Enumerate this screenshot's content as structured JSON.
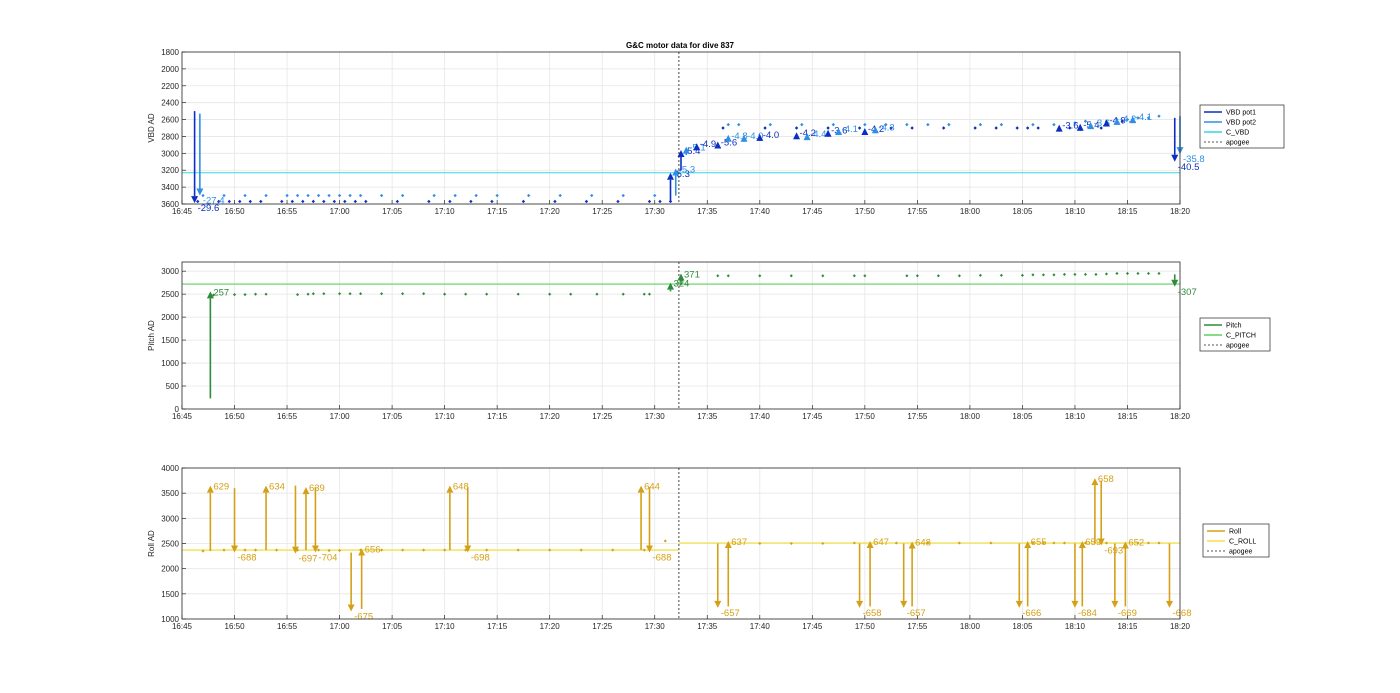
{
  "title": "G&C motor data for dive 837",
  "chart_data": [
    {
      "type": "line",
      "ylabel": "VBD AD",
      "xlabel": "",
      "ylim": [
        1800,
        3600
      ],
      "y_reversed": true,
      "yticks": [
        "1800",
        "2000",
        "2200",
        "2400",
        "2600",
        "2800",
        "3000",
        "3200",
        "3400",
        "3600"
      ],
      "xlim": [
        "16:45",
        "18:20"
      ],
      "xticks": [
        "16:45",
        "16:50",
        "16:55",
        "17:00",
        "17:05",
        "17:10",
        "17:15",
        "17:20",
        "17:25",
        "17:30",
        "17:35",
        "17:40",
        "17:45",
        "17:50",
        "17:55",
        "18:00",
        "18:05",
        "18:10",
        "18:15",
        "18:20"
      ],
      "grid": true,
      "apogee": "17:32.3",
      "legend": {
        "placement": "outside-right",
        "entries": [
          "VBD pot1",
          "VBD pot2",
          "C_VBD",
          "apogee"
        ]
      },
      "colors": {
        "VBD pot1": "#0b2fc0",
        "VBD pot2": "#2f8fe6",
        "C_VBD": "#33d6e6",
        "apogee": "#555555"
      },
      "c_vbd_level": 3230,
      "pot1_points": {
        "x": [
          "16:46.5",
          "16:48.5",
          "16:49.5",
          "16:50.5",
          "16:51.5",
          "16:52.5",
          "16:54.5",
          "16:55.5",
          "16:56.5",
          "16:57.5",
          "16:58.5",
          "16:59.5",
          "17:00.5",
          "17:01.5",
          "17:02.5",
          "17:05.5",
          "17:08.5",
          "17:10.5",
          "17:12.5",
          "17:14.5",
          "17:17.5",
          "17:20.5",
          "17:23.5",
          "17:26.5",
          "17:29.5",
          "17:30.5",
          "17:31.5",
          "17:36.5",
          "17:40.5",
          "17:43.5",
          "17:46.5",
          "17:49.5",
          "17:52.5",
          "17:54.5",
          "17:57.5",
          "18:00.5",
          "18:02.5",
          "18:04.5",
          "18:05.5",
          "18:06.5",
          "18:08.5",
          "18:09.5",
          "18:12.5",
          "18:14.5"
        ],
        "y": [
          3570,
          3570,
          3570,
          3570,
          3570,
          3570,
          3570,
          3570,
          3570,
          3570,
          3570,
          3570,
          3570,
          3570,
          3570,
          3570,
          3570,
          3570,
          3570,
          3570,
          3570,
          3570,
          3570,
          3570,
          3570,
          3570,
          3570,
          2700,
          2700,
          2700,
          2700,
          2700,
          2700,
          2700,
          2700,
          2700,
          2700,
          2700,
          2700,
          2700,
          2700,
          2700,
          2700,
          2620
        ]
      },
      "pot2_points": {
        "x": [
          "16:47",
          "16:49",
          "16:51",
          "16:53",
          "16:55",
          "16:56",
          "16:57",
          "16:58",
          "16:59",
          "17:00",
          "17:01",
          "17:02",
          "17:04",
          "17:06",
          "17:09",
          "17:11",
          "17:13",
          "17:15",
          "17:18",
          "17:21",
          "17:24",
          "17:27",
          "17:30",
          "17:37",
          "17:38",
          "17:41",
          "17:44",
          "17:47",
          "17:50",
          "17:52",
          "17:54",
          "17:56",
          "17:58",
          "18:01",
          "18:03",
          "18:06",
          "18:08",
          "18:10",
          "18:11",
          "18:13",
          "18:14",
          "18:15",
          "18:16",
          "18:17",
          "18:18"
        ],
        "y": [
          3500,
          3500,
          3500,
          3500,
          3500,
          3500,
          3500,
          3500,
          3500,
          3500,
          3500,
          3500,
          3500,
          3500,
          3500,
          3500,
          3500,
          3500,
          3500,
          3500,
          3500,
          3500,
          3500,
          2660,
          2660,
          2660,
          2660,
          2660,
          2660,
          2660,
          2660,
          2660,
          2660,
          2660,
          2660,
          2660,
          2660,
          2640,
          2620,
          2620,
          2600,
          2600,
          2580,
          2580,
          2560
        ]
      },
      "arrows": [
        {
          "series": "VBD pot1",
          "x": "16:46.2",
          "from": 2500,
          "to": 3590,
          "label": "-29.6"
        },
        {
          "series": "VBD pot2",
          "x": "16:46.7",
          "from": 2530,
          "to": 3500,
          "label": "-27.4"
        },
        {
          "series": "VBD pot1",
          "x": "17:31.5",
          "from": 3570,
          "to": 3230,
          "label": "-5.3"
        },
        {
          "series": "VBD pot2",
          "x": "17:32",
          "from": 3500,
          "to": 3180,
          "label": "-5.3"
        },
        {
          "series": "VBD pot1",
          "x": "17:32.5",
          "from": 3200,
          "to": 2960,
          "label": "-5.4"
        },
        {
          "series": "VBD pot2",
          "x": "17:33",
          "from": 3020,
          "to": 2920,
          "label": "-5.1"
        },
        {
          "series": "VBD pot1",
          "x": "17:34",
          "from": 2960,
          "to": 2880,
          "label": "-4.9"
        },
        {
          "series": "VBD pot1",
          "x": "17:36",
          "from": 2940,
          "to": 2860,
          "label": "-5.6"
        },
        {
          "series": "VBD pot2",
          "x": "17:37",
          "from": 2860,
          "to": 2780,
          "label": "-4.8"
        },
        {
          "series": "VBD pot2",
          "x": "17:38.5",
          "from": 2840,
          "to": 2780,
          "label": "-4.0"
        },
        {
          "series": "VBD pot1",
          "x": "17:40",
          "from": 2800,
          "to": 2770,
          "label": "-4.0"
        },
        {
          "series": "VBD pot1",
          "x": "17:43.5",
          "from": 2780,
          "to": 2750,
          "label": "-4.2"
        },
        {
          "series": "VBD pot2",
          "x": "17:44.5",
          "from": 2800,
          "to": 2760,
          "label": "-4.4"
        },
        {
          "series": "VBD pot1",
          "x": "17:46.5",
          "from": 2760,
          "to": 2720,
          "label": "-3.6"
        },
        {
          "series": "VBD pot2",
          "x": "17:47.5",
          "from": 2740,
          "to": 2700,
          "label": "-4.1"
        },
        {
          "series": "VBD pot1",
          "x": "17:50",
          "from": 2740,
          "to": 2700,
          "label": "-4.2"
        },
        {
          "series": "VBD pot2",
          "x": "17:51",
          "from": 2720,
          "to": 2680,
          "label": "-4.3"
        },
        {
          "series": "VBD pot1",
          "x": "18:08.5",
          "from": 2690,
          "to": 2660,
          "label": "-3.6"
        },
        {
          "series": "VBD pot1",
          "x": "18:10.5",
          "from": 2680,
          "to": 2650,
          "label": "-5.4"
        },
        {
          "series": "VBD pot2",
          "x": "18:11.5",
          "from": 2660,
          "to": 2630,
          "label": "-3.6"
        },
        {
          "series": "VBD pot1",
          "x": "18:13",
          "from": 2640,
          "to": 2600,
          "label": "-4.9"
        },
        {
          "series": "VBD pot2",
          "x": "18:14",
          "from": 2620,
          "to": 2580,
          "label": "-4.2"
        },
        {
          "series": "VBD pot2",
          "x": "18:15.5",
          "from": 2600,
          "to": 2560,
          "label": "-4.1"
        },
        {
          "series": "VBD pot1",
          "x": "18:19.5",
          "from": 2580,
          "to": 3100,
          "label": "-40.5"
        },
        {
          "series": "VBD pot2",
          "x": "18:20",
          "from": 2560,
          "to": 3010,
          "label": "-35.8"
        }
      ]
    },
    {
      "type": "line",
      "ylabel": "Pitch AD",
      "xlabel": "",
      "ylim": [
        0,
        3200
      ],
      "yticks": [
        "0",
        "500",
        "1000",
        "1500",
        "2000",
        "2500",
        "3000"
      ],
      "xlim": [
        "16:45",
        "18:20"
      ],
      "xticks": [
        "16:45",
        "16:50",
        "16:55",
        "17:00",
        "17:05",
        "17:10",
        "17:15",
        "17:20",
        "17:25",
        "17:30",
        "17:35",
        "17:40",
        "17:45",
        "17:50",
        "17:55",
        "18:00",
        "18:05",
        "18:10",
        "18:15",
        "18:20"
      ],
      "grid": true,
      "apogee": "17:32.3",
      "legend": {
        "placement": "outside-right",
        "entries": [
          "Pitch",
          "C_PITCH",
          "apogee"
        ]
      },
      "colors": {
        "Pitch": "#2e8b3a",
        "C_PITCH": "#5ed05e",
        "apogee": "#555555"
      },
      "c_pitch_level": 2720,
      "points": {
        "x": [
          "16:48",
          "16:50",
          "16:51",
          "16:52",
          "16:53",
          "16:56",
          "16:57",
          "16:57.5",
          "16:58.5",
          "17:00",
          "17:01",
          "17:02",
          "17:04",
          "17:06",
          "17:08",
          "17:10",
          "17:12",
          "17:14",
          "17:17",
          "17:20",
          "17:22",
          "17:24.5",
          "17:27",
          "17:29",
          "17:29.5",
          "17:36",
          "17:37",
          "17:40",
          "17:43",
          "17:46",
          "17:49",
          "17:50",
          "17:54",
          "17:55",
          "17:57",
          "17:59",
          "18:01",
          "18:03",
          "18:05",
          "18:06",
          "18:07",
          "18:08",
          "18:09",
          "18:10",
          "18:11",
          "18:12",
          "18:13",
          "18:14",
          "18:15",
          "18:16",
          "18:17",
          "18:18"
        ],
        "y": [
          2480,
          2490,
          2490,
          2500,
          2500,
          2490,
          2500,
          2510,
          2510,
          2510,
          2510,
          2510,
          2510,
          2510,
          2510,
          2500,
          2500,
          2500,
          2500,
          2500,
          2500,
          2500,
          2500,
          2500,
          2500,
          2900,
          2900,
          2900,
          2900,
          2900,
          2900,
          2900,
          2900,
          2900,
          2900,
          2900,
          2910,
          2910,
          2910,
          2920,
          2920,
          2920,
          2930,
          2930,
          2930,
          2930,
          2940,
          2950,
          2950,
          2950,
          2950,
          2950
        ]
      },
      "arrows": [
        {
          "x": "16:47.7",
          "from": 230,
          "to": 2560,
          "label": "257"
        },
        {
          "x": "17:31.5",
          "from": 2560,
          "to": 2750,
          "label": "324"
        },
        {
          "x": "17:32.5",
          "from": 2700,
          "to": 2950,
          "label": "371"
        },
        {
          "x": "18:19.5",
          "from": 2930,
          "to": 2660,
          "label": "-307"
        }
      ]
    },
    {
      "type": "line",
      "ylabel": "Roll AD",
      "xlabel": "",
      "ylim": [
        1000,
        4000
      ],
      "yticks": [
        "1000",
        "1500",
        "2000",
        "2500",
        "3000",
        "3500",
        "4000"
      ],
      "xlim": [
        "16:45",
        "18:20"
      ],
      "xticks": [
        "16:45",
        "16:50",
        "16:55",
        "17:00",
        "17:05",
        "17:10",
        "17:15",
        "17:20",
        "17:25",
        "17:30",
        "17:35",
        "17:40",
        "17:45",
        "17:50",
        "17:55",
        "18:00",
        "18:05",
        "18:10",
        "18:15",
        "18:20"
      ],
      "grid": true,
      "apogee": "17:32.3",
      "legend": {
        "placement": "outside-right",
        "entries": [
          "Roll",
          "C_ROLL",
          "apogee"
        ]
      },
      "colors": {
        "Roll": "#d4a017",
        "C_ROLL": "#f2e14a",
        "apogee": "#555555"
      },
      "c_roll_levels": [
        {
          "from": "16:45",
          "to": "17:32.3",
          "y": 2370
        },
        {
          "from": "17:32.3",
          "to": "18:20",
          "y": 2510
        }
      ],
      "points": {
        "x": [
          "16:47",
          "16:49",
          "16:51",
          "16:52",
          "16:54",
          "16:56",
          "16:58",
          "16:59",
          "17:00",
          "17:02",
          "17:04",
          "17:06",
          "17:08",
          "17:10",
          "17:12",
          "17:14",
          "17:17",
          "17:20",
          "17:23",
          "17:26",
          "17:29",
          "17:31",
          "17:40",
          "17:43",
          "17:46",
          "17:49",
          "17:53",
          "17:56",
          "17:59",
          "18:02",
          "18:06",
          "18:07",
          "18:08",
          "18:09",
          "18:11",
          "18:13",
          "18:16",
          "18:17",
          "18:18"
        ],
        "y": [
          2350,
          2370,
          2370,
          2370,
          2370,
          2370,
          2370,
          2360,
          2360,
          2370,
          2370,
          2370,
          2370,
          2370,
          2370,
          2370,
          2370,
          2370,
          2370,
          2370,
          2370,
          2550,
          2500,
          2500,
          2500,
          2510,
          2510,
          2510,
          2510,
          2510,
          2510,
          2510,
          2510,
          2510,
          2510,
          2510,
          2510,
          2510,
          2510
        ]
      },
      "arrows": [
        {
          "x": "16:47.7",
          "from": 2350,
          "to": 3650,
          "label": "629"
        },
        {
          "x": "16:50",
          "from": 3600,
          "to": 2320,
          "label": "-688"
        },
        {
          "x": "16:53",
          "from": 2370,
          "to": 3650,
          "label": "634"
        },
        {
          "x": "16:55.8",
          "from": 3650,
          "to": 2300,
          "label": "-697"
        },
        {
          "x": "16:56.8",
          "from": 2370,
          "to": 3620,
          "label": "639"
        },
        {
          "x": "16:57.7",
          "from": 3620,
          "to": 2320,
          "label": "-704"
        },
        {
          "x": "17:01.1",
          "from": 2320,
          "to": 1150,
          "label": "-675"
        },
        {
          "x": "17:02.1",
          "from": 1200,
          "to": 2400,
          "label": "656"
        },
        {
          "x": "17:10.5",
          "from": 2370,
          "to": 3650,
          "label": "648"
        },
        {
          "x": "17:12.2",
          "from": 3620,
          "to": 2320,
          "label": "-698"
        },
        {
          "x": "17:28.7",
          "from": 2370,
          "to": 3650,
          "label": "644"
        },
        {
          "x": "17:29.5",
          "from": 3620,
          "to": 2320,
          "label": "-688"
        },
        {
          "x": "17:36",
          "from": 2500,
          "to": 1220,
          "label": "-657"
        },
        {
          "x": "17:37",
          "from": 1250,
          "to": 2550,
          "label": "637"
        },
        {
          "x": "17:49.5",
          "from": 2500,
          "to": 1220,
          "label": "-658"
        },
        {
          "x": "17:50.5",
          "from": 1250,
          "to": 2550,
          "label": "647"
        },
        {
          "x": "17:53.7",
          "from": 2500,
          "to": 1220,
          "label": "-657"
        },
        {
          "x": "17:54.5",
          "from": 1250,
          "to": 2540,
          "label": "648"
        },
        {
          "x": "18:04.7",
          "from": 2500,
          "to": 1220,
          "label": "-666"
        },
        {
          "x": "18:05.5",
          "from": 1250,
          "to": 2550,
          "label": "655"
        },
        {
          "x": "18:10",
          "from": 2500,
          "to": 1220,
          "label": "-684"
        },
        {
          "x": "18:10.7",
          "from": 1250,
          "to": 2550,
          "label": "659"
        },
        {
          "x": "18:11.9",
          "from": 2500,
          "to": 3800,
          "label": "658"
        },
        {
          "x": "18:12.5",
          "from": 3750,
          "to": 2460,
          "label": "-693"
        },
        {
          "x": "18:13.8",
          "from": 2500,
          "to": 1220,
          "label": "-669"
        },
        {
          "x": "18:14.8",
          "from": 1250,
          "to": 2540,
          "label": "652"
        },
        {
          "x": "18:19",
          "from": 2500,
          "to": 1220,
          "label": "-668"
        }
      ]
    }
  ]
}
